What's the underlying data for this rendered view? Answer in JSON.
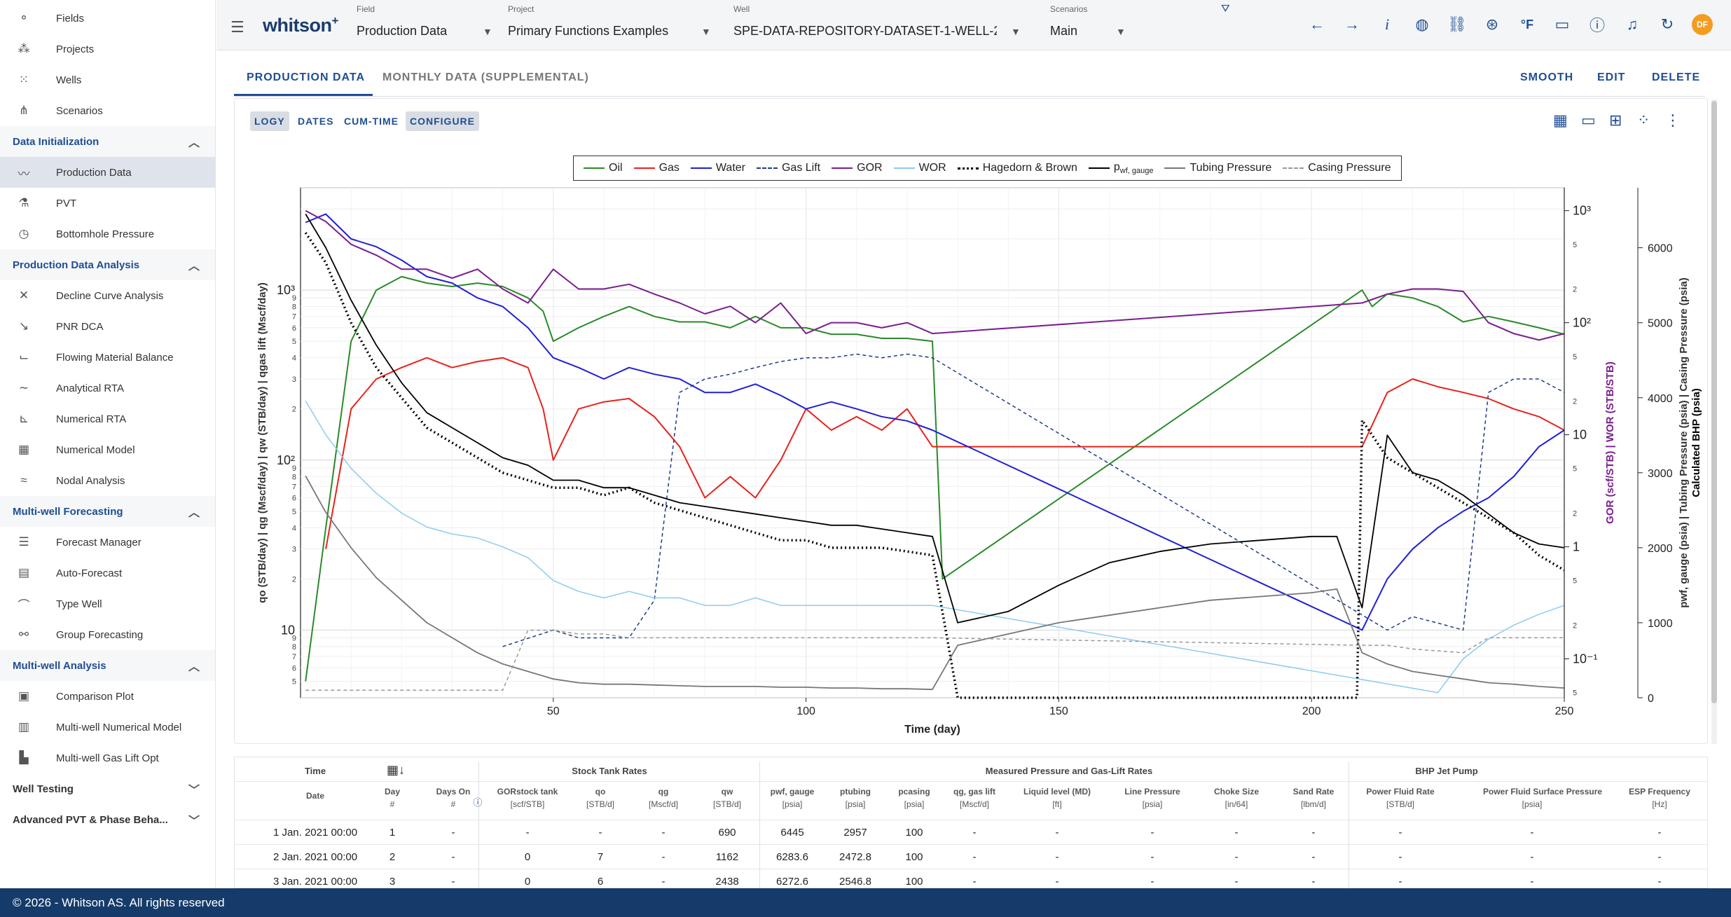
{
  "sidebar": {
    "top_items": [
      {
        "label": "Fields",
        "icon": "fields-icon"
      },
      {
        "label": "Projects",
        "icon": "projects-icon"
      },
      {
        "label": "Wells",
        "icon": "wells-icon"
      },
      {
        "label": "Scenarios",
        "icon": "scenarios-icon"
      }
    ],
    "sections": [
      {
        "title": "Data Initialization",
        "items": [
          {
            "label": "Production Data",
            "icon": "trend-icon"
          },
          {
            "label": "PVT",
            "icon": "flask-icon"
          },
          {
            "label": "Bottomhole Pressure",
            "icon": "gauge-icon"
          }
        ]
      },
      {
        "title": "Production Data Analysis",
        "items": [
          {
            "label": "Decline Curve Analysis",
            "icon": "decline-icon"
          },
          {
            "label": "PNR DCA",
            "icon": "pnr-icon"
          },
          {
            "label": "Flowing Material Balance",
            "icon": "fmb-icon"
          },
          {
            "label": "Analytical RTA",
            "icon": "rta-icon"
          },
          {
            "label": "Numerical RTA",
            "icon": "numerical-rta-icon"
          },
          {
            "label": "Numerical Model",
            "icon": "building-icon"
          },
          {
            "label": "Nodal Analysis",
            "icon": "nodal-icon"
          }
        ]
      },
      {
        "title": "Multi-well Forecasting",
        "items": [
          {
            "label": "Forecast Manager",
            "icon": "list-icon"
          },
          {
            "label": "Auto-Forecast",
            "icon": "grid-icon"
          },
          {
            "label": "Type Well",
            "icon": "typewell-icon"
          },
          {
            "label": "Group Forecasting",
            "icon": "group-icon"
          }
        ]
      },
      {
        "title": "Multi-well Analysis",
        "items": [
          {
            "label": "Comparison Plot",
            "icon": "compare-icon"
          },
          {
            "label": "Multi-well Numerical Model",
            "icon": "bars-icon"
          },
          {
            "label": "Multi-well Gas Lift Opt",
            "icon": "gaslift-icon"
          }
        ]
      }
    ],
    "collapsed": [
      "Well Testing",
      "Advanced PVT & Phase Beha..."
    ]
  },
  "footer": "© 2026 - Whitson AS. All rights reserved",
  "topbar": {
    "logo": "whitson",
    "logo_sup": "+",
    "selectors": [
      {
        "label": "Field",
        "value": "Production Data"
      },
      {
        "label": "Project",
        "value": "Primary Functions Examples"
      },
      {
        "label": "Well",
        "value": "SPE-DATA-REPOSITORY-DATASET-1-WELL-2-HAV"
      },
      {
        "label": "Scenarios",
        "value": "Main"
      }
    ],
    "avatar": "DF"
  },
  "tabs": [
    "PRODUCTION DATA",
    "MONTHLY DATA (SUPPLEMENTAL)"
  ],
  "actions": [
    "SMOOTH",
    "EDIT",
    "DELETE"
  ],
  "chips": [
    "LOGY",
    "DATES",
    "CUM-TIME",
    "CONFIGURE"
  ],
  "legend": [
    "Oil",
    "Gas",
    "Water",
    "Gas Lift",
    "GOR",
    "WOR",
    "Hagedorn & Brown",
    "Tubing Pressure",
    "Casing Pressure"
  ],
  "colors": {
    "oil": "#2a8a2a",
    "gas": "#e8221c",
    "water": "#1f1fd6",
    "gor": "#7b1e8e",
    "wor": "#8ccbf0",
    "hb": "#000000",
    "tubing": "#777777",
    "casing": "#999999",
    "accent": "#1f4e93"
  },
  "chart_data": {
    "type": "line",
    "xlabel": "Time (day)",
    "xlim": [
      0,
      250
    ],
    "xticks": [
      50,
      100,
      150,
      200,
      250
    ],
    "left_axis_label": "qo (STB/day) | qg (Mscf/day) | qw (STB/day) | qgas lift (Mscf/day)",
    "left_ticks": [
      "10",
      "10²",
      "10³"
    ],
    "ratio_axis_label": "GOR (scf/STB) | WOR (STB/STB)",
    "ratio_ticks": [
      "10⁻¹",
      "1",
      "10",
      "10²",
      "10³"
    ],
    "pressure_axis_label": "pwf, gauge (psia) | Tubing Pressure (psia) | Casing Pressure (psia)",
    "pressure_axis_label2": "Calculated BHP (psia)",
    "pressure_ticks": [
      0,
      1000,
      2000,
      3000,
      4000,
      5000,
      6000
    ],
    "series": [
      {
        "name": "Oil",
        "x": [
          1,
          5,
          10,
          15,
          20,
          25,
          30,
          35,
          40,
          45,
          48,
          50,
          55,
          60,
          65,
          70,
          75,
          80,
          85,
          90,
          95,
          100,
          105,
          110,
          115,
          120,
          125,
          127,
          210,
          212,
          215,
          220,
          225,
          230,
          235,
          240,
          245,
          250
        ],
        "y": [
          5,
          40,
          500,
          1000,
          1200,
          1100,
          1050,
          1100,
          1050,
          900,
          750,
          500,
          600,
          700,
          800,
          700,
          650,
          650,
          600,
          700,
          600,
          600,
          550,
          550,
          520,
          520,
          500,
          20,
          1000,
          800,
          950,
          900,
          800,
          650,
          700,
          650,
          600,
          550
        ]
      },
      {
        "name": "Gas",
        "x": [
          5,
          10,
          15,
          20,
          25,
          30,
          35,
          40,
          45,
          48,
          50,
          55,
          60,
          65,
          70,
          75,
          80,
          85,
          90,
          95,
          100,
          105,
          110,
          115,
          120,
          125,
          210,
          215,
          220,
          225,
          230,
          235,
          240,
          245,
          250
        ],
        "y": [
          30,
          200,
          300,
          350,
          400,
          350,
          380,
          400,
          350,
          200,
          100,
          200,
          220,
          230,
          180,
          120,
          60,
          80,
          60,
          100,
          200,
          150,
          180,
          150,
          200,
          120,
          120,
          250,
          300,
          270,
          250,
          230,
          200,
          180,
          150
        ]
      },
      {
        "name": "Water",
        "x": [
          1,
          5,
          10,
          15,
          20,
          25,
          30,
          35,
          40,
          45,
          50,
          55,
          60,
          65,
          70,
          75,
          80,
          85,
          90,
          95,
          100,
          105,
          110,
          115,
          120,
          125,
          210,
          215,
          220,
          225,
          230,
          235,
          240,
          245,
          250
        ],
        "y": [
          2500,
          2800,
          2000,
          1800,
          1500,
          1200,
          1100,
          900,
          800,
          600,
          400,
          350,
          300,
          350,
          320,
          300,
          250,
          250,
          280,
          240,
          200,
          220,
          200,
          180,
          170,
          150,
          10,
          20,
          30,
          40,
          50,
          60,
          80,
          120,
          150
        ]
      },
      {
        "name": "Gas Lift",
        "x": [
          40,
          50,
          55,
          60,
          65,
          70,
          75,
          80,
          85,
          90,
          95,
          100,
          105,
          110,
          115,
          120,
          125,
          215,
          220,
          225,
          230,
          235,
          240,
          245,
          250
        ],
        "y": [
          8,
          10,
          9,
          9,
          9,
          15,
          250,
          300,
          320,
          350,
          380,
          400,
          400,
          420,
          400,
          420,
          400,
          10,
          12,
          11,
          10,
          250,
          300,
          300,
          250
        ]
      },
      {
        "name": "GOR",
        "x": [
          1,
          5,
          10,
          15,
          20,
          25,
          30,
          35,
          40,
          45,
          50,
          55,
          60,
          65,
          70,
          75,
          80,
          85,
          90,
          95,
          100,
          105,
          110,
          115,
          120,
          125,
          210,
          215,
          220,
          225,
          230,
          235,
          240,
          245,
          250
        ],
        "y": [
          1000,
          800,
          500,
          400,
          300,
          300,
          250,
          300,
          200,
          150,
          300,
          200,
          200,
          220,
          180,
          150,
          120,
          140,
          100,
          150,
          80,
          100,
          100,
          90,
          100,
          80,
          150,
          180,
          200,
          200,
          190,
          100,
          80,
          70,
          80
        ]
      },
      {
        "name": "WOR",
        "x": [
          1,
          5,
          10,
          15,
          20,
          25,
          30,
          35,
          40,
          45,
          50,
          55,
          60,
          65,
          70,
          75,
          80,
          85,
          90,
          95,
          100,
          105,
          110,
          115,
          120,
          125,
          225,
          230,
          235,
          240,
          245,
          250
        ],
        "y": [
          20,
          10,
          5,
          3,
          2,
          1.5,
          1.3,
          1.2,
          1,
          0.8,
          0.5,
          0.4,
          0.35,
          0.4,
          0.35,
          0.35,
          0.3,
          0.3,
          0.35,
          0.3,
          0.3,
          0.3,
          0.3,
          0.3,
          0.3,
          0.3,
          0.05,
          0.1,
          0.15,
          0.2,
          0.25,
          0.3
        ]
      },
      {
        "name": "Hagedorn & Brown",
        "x": [
          1,
          5,
          10,
          15,
          20,
          25,
          30,
          35,
          40,
          45,
          50,
          55,
          60,
          65,
          70,
          75,
          80,
          85,
          90,
          95,
          100,
          105,
          110,
          115,
          120,
          125,
          130,
          209,
          210,
          215,
          220,
          225,
          230,
          235,
          240,
          245,
          250
        ],
        "y": [
          6200,
          5800,
          5000,
          4400,
          4000,
          3600,
          3400,
          3200,
          3000,
          2900,
          2800,
          2800,
          2700,
          2800,
          2600,
          2500,
          2400,
          2300,
          2200,
          2100,
          2100,
          2000,
          2000,
          2000,
          1950,
          1900,
          0,
          0,
          3700,
          3200,
          3000,
          2800,
          2600,
          2400,
          2200,
          1900,
          1700
        ]
      },
      {
        "name": "pwf, gauge",
        "x": [
          1,
          5,
          10,
          15,
          20,
          25,
          30,
          35,
          40,
          45,
          50,
          55,
          60,
          65,
          70,
          75,
          80,
          85,
          90,
          95,
          100,
          105,
          110,
          115,
          120,
          125,
          130,
          140,
          150,
          160,
          170,
          180,
          190,
          200,
          205,
          210,
          215,
          220,
          225,
          230,
          235,
          240,
          245,
          250
        ],
        "y": [
          6450,
          6000,
          5300,
          4700,
          4200,
          3800,
          3600,
          3400,
          3200,
          3100,
          2900,
          2900,
          2800,
          2800,
          2700,
          2600,
          2550,
          2500,
          2450,
          2400,
          2350,
          2300,
          2300,
          2250,
          2200,
          2150,
          1000,
          1150,
          1500,
          1800,
          1950,
          2050,
          2100,
          2150,
          2150,
          1200,
          3500,
          3000,
          2900,
          2700,
          2450,
          2200,
          2050,
          2000
        ]
      },
      {
        "name": "Tubing Pressure",
        "x": [
          1,
          5,
          10,
          15,
          20,
          25,
          30,
          35,
          40,
          45,
          50,
          55,
          60,
          65,
          70,
          75,
          80,
          85,
          90,
          95,
          100,
          105,
          110,
          115,
          120,
          125,
          130,
          140,
          150,
          160,
          170,
          180,
          190,
          200,
          205,
          210,
          215,
          220,
          225,
          230,
          235,
          240,
          245,
          250
        ],
        "y": [
          2957,
          2472,
          2000,
          1600,
          1300,
          1000,
          800,
          600,
          450,
          350,
          250,
          200,
          180,
          180,
          170,
          160,
          150,
          150,
          150,
          140,
          140,
          130,
          130,
          120,
          120,
          110,
          700,
          850,
          1000,
          1100,
          1200,
          1300,
          1350,
          1400,
          1450,
          600,
          450,
          350,
          300,
          250,
          200,
          180,
          150,
          130
        ]
      },
      {
        "name": "Casing Pressure",
        "x": [
          1,
          10,
          20,
          30,
          40,
          45,
          50,
          55,
          60,
          65,
          70,
          80,
          90,
          100,
          110,
          120,
          125,
          210,
          215,
          220,
          230,
          235,
          240,
          250
        ],
        "y": [
          100,
          100,
          100,
          100,
          100,
          900,
          900,
          850,
          850,
          800,
          800,
          800,
          800,
          800,
          800,
          800,
          800,
          700,
          700,
          650,
          600,
          800,
          800,
          800
        ]
      }
    ]
  },
  "table": {
    "group_headers": [
      "Stock Tank Rates",
      "Measured Pressure and Gas-Lift Rates",
      "BHP Jet Pump"
    ],
    "top_labels": [
      "Time"
    ],
    "columns": [
      {
        "title": "Date",
        "unit": ""
      },
      {
        "title": "Day",
        "unit": "#"
      },
      {
        "title": "Days On",
        "unit": "#"
      },
      {
        "title": "GORstock tank",
        "unit": "[scf/STB]"
      },
      {
        "title": "qo",
        "unit": "[STB/d]"
      },
      {
        "title": "qg",
        "unit": "[Mscf/d]"
      },
      {
        "title": "qw",
        "unit": "[STB/d]"
      },
      {
        "title": "pwf, gauge",
        "unit": "[psia]"
      },
      {
        "title": "ptubing",
        "unit": "[psia]"
      },
      {
        "title": "pcasing",
        "unit": "[psia]"
      },
      {
        "title": "qg, gas lift",
        "unit": "[Mscf/d]"
      },
      {
        "title": "Liquid level (MD)",
        "unit": "[ft]"
      },
      {
        "title": "Line Pressure",
        "unit": "[psia]"
      },
      {
        "title": "Choke Size",
        "unit": "[in/64]"
      },
      {
        "title": "Sand Rate",
        "unit": "[lbm/d]"
      },
      {
        "title": "Power Fluid Rate",
        "unit": "[STB/d]"
      },
      {
        "title": "Power Fluid Surface Pressure",
        "unit": "[psia]"
      },
      {
        "title": "ESP Frequency",
        "unit": "[Hz]"
      }
    ],
    "rows": [
      [
        "1 Jan. 2021 00:00",
        "1",
        "-",
        "-",
        "-",
        "-",
        "690",
        "6445",
        "2957",
        "100",
        "-",
        "-",
        "-",
        "-",
        "-",
        "-",
        "-",
        "-"
      ],
      [
        "2 Jan. 2021 00:00",
        "2",
        "-",
        "0",
        "7",
        "-",
        "1162",
        "6283.6",
        "2472.8",
        "100",
        "-",
        "-",
        "-",
        "-",
        "-",
        "-",
        "-",
        "-"
      ],
      [
        "3 Jan. 2021 00:00",
        "3",
        "-",
        "0",
        "6",
        "-",
        "2438",
        "6272.6",
        "2546.8",
        "100",
        "-",
        "-",
        "-",
        "-",
        "-",
        "-",
        "-",
        "-"
      ]
    ]
  }
}
